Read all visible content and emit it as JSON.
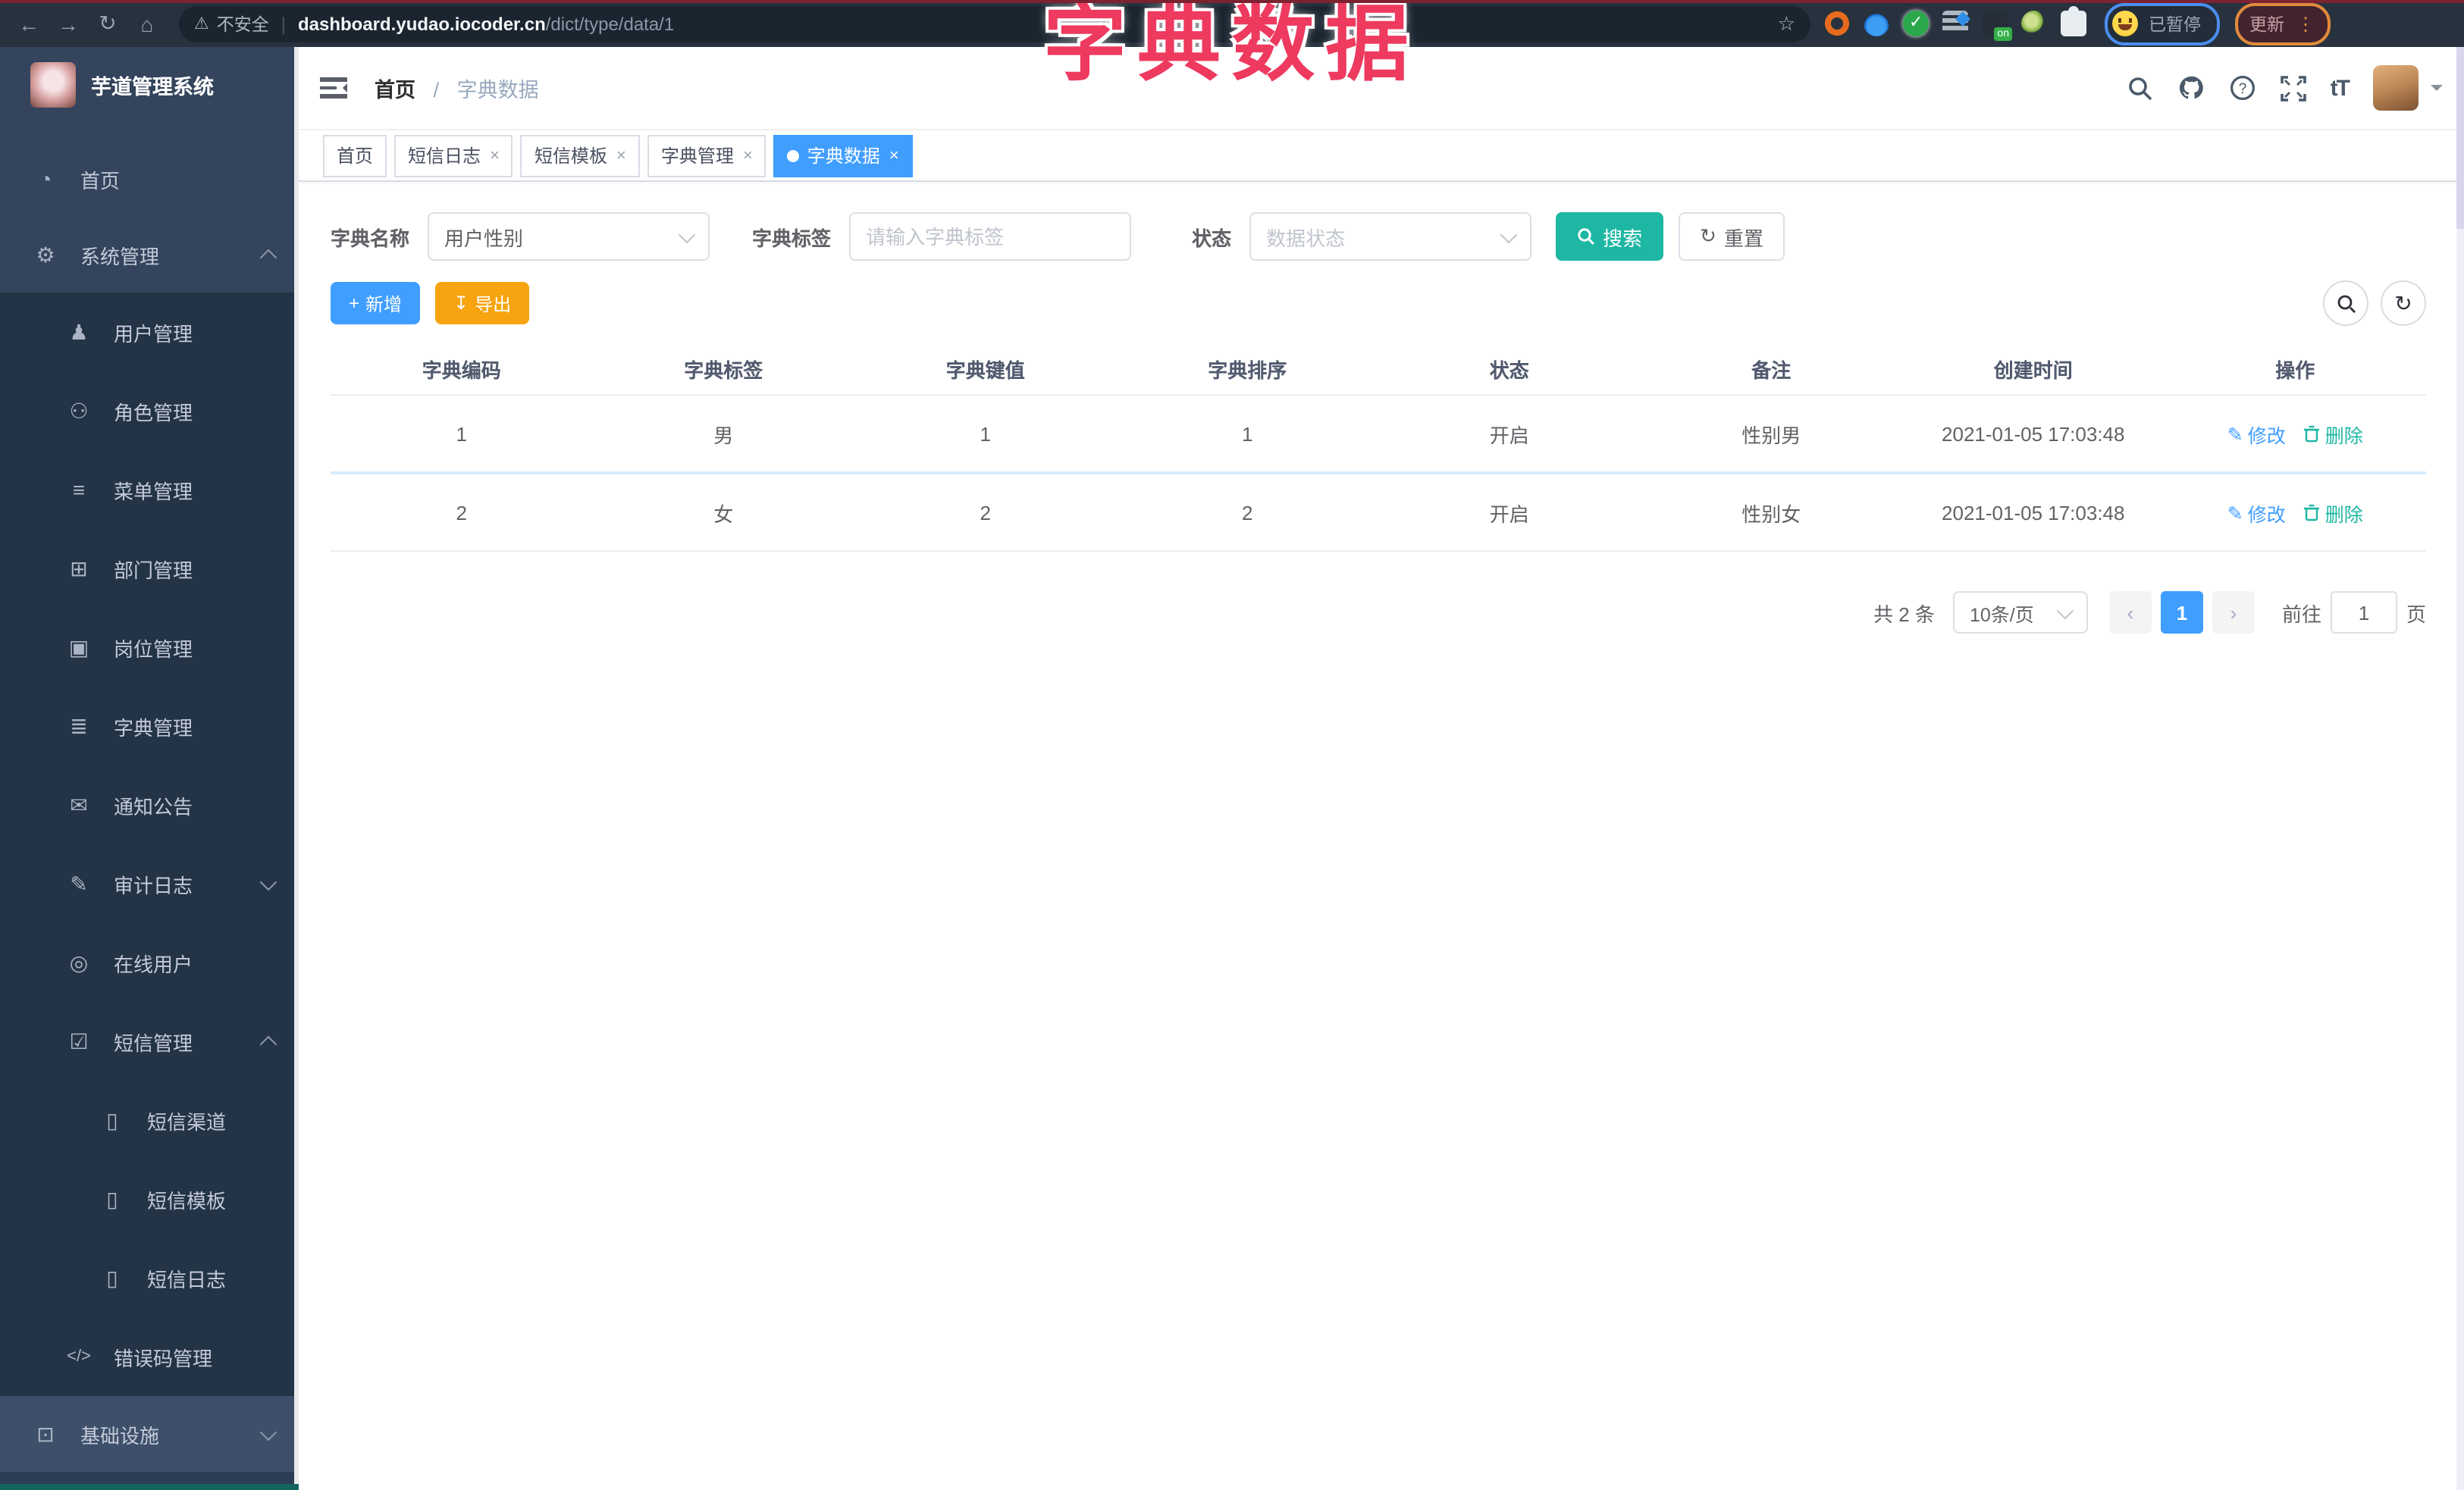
{
  "overlay_title": "字典数据",
  "browser": {
    "back_glyph": "←",
    "forward_glyph": "→",
    "reload_glyph": "↻",
    "home_glyph": "⌂",
    "warning_glyph": "⚠",
    "security_label": "不安全",
    "url_host": "dashboard.yudao.iocoder.cn",
    "url_path": "/dict/type/data/1",
    "star_glyph": "☆",
    "extension_on_badge": "on",
    "profile_status": "已暂停",
    "update_label": "更新",
    "menu_dots_glyph": "⋮"
  },
  "sidebar": {
    "logo_title": "芋道管理系统",
    "items": [
      {
        "label": "首页",
        "glyph": "◔"
      },
      {
        "label": "系统管理",
        "glyph": "⚙"
      },
      {
        "label": "用户管理",
        "glyph": "♟"
      },
      {
        "label": "角色管理",
        "glyph": "⚇"
      },
      {
        "label": "菜单管理",
        "glyph": "≡"
      },
      {
        "label": "部门管理",
        "glyph": "⊞"
      },
      {
        "label": "岗位管理",
        "glyph": "▣"
      },
      {
        "label": "字典管理",
        "glyph": "≣"
      },
      {
        "label": "通知公告",
        "glyph": "✉"
      },
      {
        "label": "审计日志",
        "glyph": "✎"
      },
      {
        "label": "在线用户",
        "glyph": "◎"
      },
      {
        "label": "短信管理",
        "glyph": "☑"
      },
      {
        "label": "短信渠道",
        "glyph": "▯"
      },
      {
        "label": "短信模板",
        "glyph": "▯"
      },
      {
        "label": "短信日志",
        "glyph": "▯"
      },
      {
        "label": "错误码管理",
        "glyph": "</>"
      },
      {
        "label": "基础设施",
        "glyph": "⊡"
      }
    ]
  },
  "header": {
    "breadcrumb_home": "首页",
    "breadcrumb_separator": "/",
    "breadcrumb_current": "字典数据",
    "font_size_icon_text": "tT"
  },
  "tabs": [
    {
      "label": "首页"
    },
    {
      "label": "短信日志"
    },
    {
      "label": "短信模板"
    },
    {
      "label": "字典管理"
    },
    {
      "label": "字典数据"
    }
  ],
  "ui": {
    "close_glyph": "×",
    "refresh_glyph": "↻",
    "plus_glyph": "+",
    "download_glyph": "↧",
    "edit_glyph": "✎"
  },
  "filters": {
    "dict_name_label": "字典名称",
    "dict_name_value": "用户性别",
    "dict_label_label": "字典标签",
    "dict_label_placeholder": "请输入字典标签",
    "status_label": "状态",
    "status_placeholder": "数据状态",
    "search_button": "搜索",
    "reset_button": "重置"
  },
  "toolbar": {
    "add_button": "新增",
    "export_button": "导出"
  },
  "table": {
    "headers": [
      "字典编码",
      "字典标签",
      "字典键值",
      "字典排序",
      "状态",
      "备注",
      "创建时间",
      "操作"
    ],
    "edit_label": "修改",
    "delete_label": "删除",
    "rows": [
      {
        "code": "1",
        "label": "男",
        "value": "1",
        "sort": "1",
        "status": "开启",
        "remark": "性别男",
        "created": "2021-01-05 17:03:48"
      },
      {
        "code": "2",
        "label": "女",
        "value": "2",
        "sort": "2",
        "status": "开启",
        "remark": "性别女",
        "created": "2021-01-05 17:03:48"
      }
    ]
  },
  "pagination": {
    "total_label": "共 2 条",
    "page_size_label": "10条/页",
    "prev_glyph": "‹",
    "next_glyph": "›",
    "current_page": "1",
    "goto_label": "前往",
    "goto_value": "1",
    "page_suffix_label": "页"
  },
  "colors": {
    "primary_blue": "#409eff",
    "teal_accent": "#1db7a4",
    "export_orange": "#f7a410",
    "overlay_pink": "#ee3a5f",
    "sidebar_bg": "#304156"
  }
}
